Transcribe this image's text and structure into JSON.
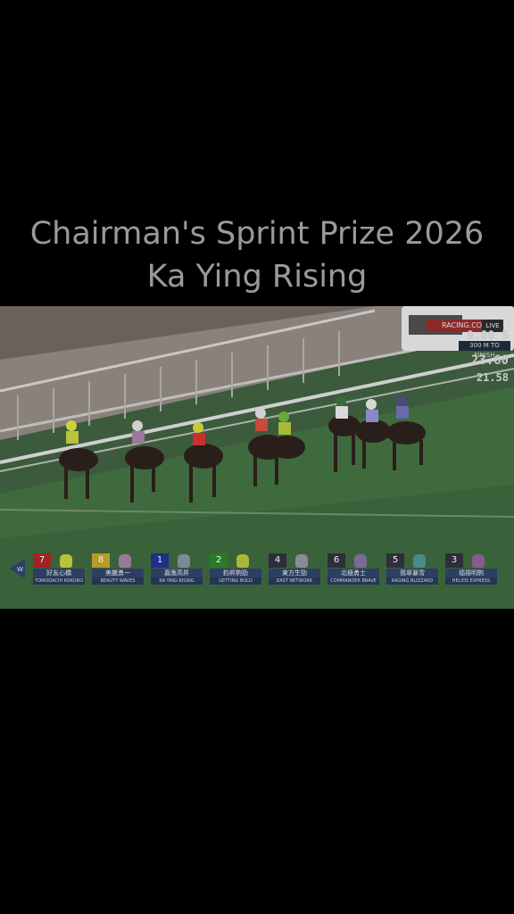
{
  "title": {
    "line1": "Chairman's Sprint Prize 2026",
    "line2": "Ka Ying Rising"
  },
  "broadcast": {
    "logo": "RACING.COM",
    "live": "LIVE",
    "odds_top": "0.00 5",
    "to_finish": "300 M TO FINISH",
    "odds_mid": "23.60",
    "odds_low": "21.58",
    "distance_marker": "300m"
  },
  "runners": [
    {
      "number": "7",
      "cn": "好友心橋",
      "en": "TOMODACHI KOKORO",
      "num_color": "#a02424",
      "silk_color": "#b8c23a"
    },
    {
      "number": "8",
      "cn": "美麗勇一",
      "en": "BEAUTY WAVES",
      "num_color": "#b89a2a",
      "silk_color": "#9a7a9a"
    },
    {
      "number": "1",
      "cn": "嘉應高昇",
      "en": "KA YING RISING",
      "num_color": "#1f2f8a",
      "silk_color": "#7a8a9a"
    },
    {
      "number": "2",
      "cn": "鈞昇駒勁",
      "en": "GETTING BOLD",
      "num_color": "#2a7a2a",
      "silk_color": "#a8b83a"
    },
    {
      "number": "4",
      "cn": "東方生勁",
      "en": "EAST NETWORK",
      "num_color": "#2e2e3a",
      "silk_color": "#8a8a9a"
    },
    {
      "number": "6",
      "cn": "北極勇士",
      "en": "COMMANDER BRAVE",
      "num_color": "#2e2e3a",
      "silk_color": "#7a6a9a"
    },
    {
      "number": "5",
      "cn": "翡翠暴雪",
      "en": "RAGING BLIZZARD",
      "num_color": "#2e2e3a",
      "silk_color": "#4a8a8a"
    },
    {
      "number": "3",
      "cn": "福揚明駒",
      "en": "HELIOS EXPRESS",
      "num_color": "#2e2e3a",
      "silk_color": "#8a5a8a"
    }
  ]
}
